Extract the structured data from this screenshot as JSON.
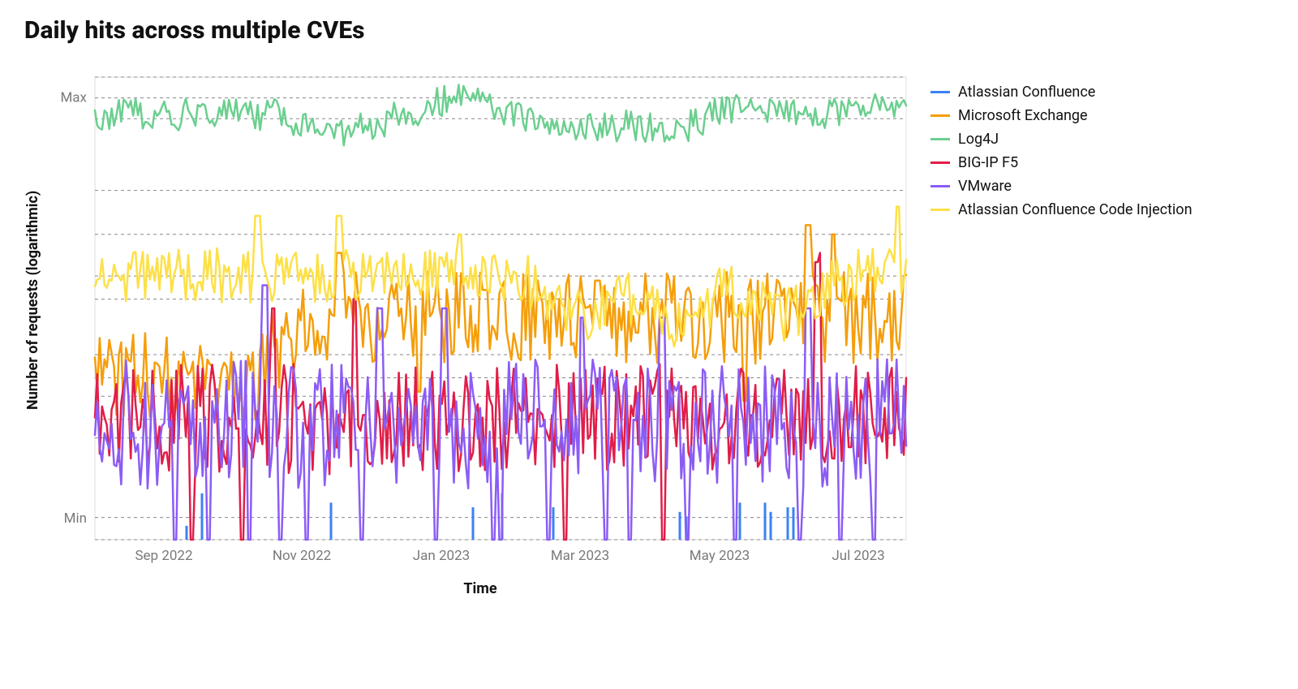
{
  "chart_data": {
    "type": "line",
    "title": "Daily hits across multiple CVEs",
    "xlabel": "Time",
    "ylabel": "Number of requests (logarithmic)",
    "y_ticks": [
      "Min",
      "Max"
    ],
    "x_ticks": [
      "Sep 2022",
      "Nov 2022",
      "Jan 2023",
      "Mar 2023",
      "May 2023",
      "Jul 2023"
    ],
    "x_tick_positions": [
      0.085,
      0.255,
      0.427,
      0.598,
      0.77,
      0.941
    ],
    "y_gridlines": [
      0.0,
      0.048,
      0.22,
      0.26,
      0.31,
      0.35,
      0.4,
      0.52,
      0.57,
      0.66,
      0.755,
      0.91,
      0.955,
      1.0
    ],
    "ylim_visual": [
      0,
      1
    ],
    "x_n_points": 340,
    "series": [
      {
        "name": "Atlassian Confluence",
        "color": "#3b82f6",
        "style": "stubs",
        "stub_x": [
          0.113,
          0.132,
          0.291,
          0.466,
          0.502,
          0.565,
          0.721,
          0.729,
          0.795,
          0.826,
          0.833,
          0.854,
          0.861
        ],
        "stub_y": [
          0.03,
          0.1,
          0.08,
          0.07,
          0.1,
          0.07,
          0.06,
          0.05,
          0.08,
          0.08,
          0.06,
          0.07,
          0.07
        ]
      },
      {
        "name": "Microsoft Exchange",
        "color": "#f59e0b",
        "style": "line",
        "profile": {
          "base": 0.35,
          "amp": 0.1,
          "rise_start": 0.18,
          "rise_end": 0.28,
          "rise_to": 0.48,
          "spikes": [
            [
              0.3,
              0.62
            ],
            [
              0.48,
              0.54
            ],
            [
              0.62,
              0.56
            ],
            [
              0.88,
              0.68
            ],
            [
              0.91,
              0.66
            ]
          ],
          "drops": [
            [
              0.2,
              0.26
            ],
            [
              0.4,
              0.32
            ],
            [
              0.8,
              0.3
            ]
          ]
        }
      },
      {
        "name": "Log4J",
        "color": "#6bcf8f",
        "style": "line",
        "profile": {
          "base": 0.92,
          "amp": 0.035,
          "dip": [
            [
              0.3,
              0.87
            ],
            [
              0.6,
              0.88
            ],
            [
              0.7,
              0.88
            ]
          ],
          "peak": [
            [
              0.45,
              0.97
            ],
            [
              0.8,
              0.94
            ],
            [
              0.99,
              0.95
            ]
          ]
        }
      },
      {
        "name": "BIG-IP F5",
        "color": "#e11d48",
        "style": "line",
        "profile": {
          "base": 0.26,
          "amp": 0.12,
          "drops": [
            [
              0.12,
              0.0
            ],
            [
              0.18,
              0.0
            ],
            [
              0.58,
              0.0
            ],
            [
              0.7,
              0.0
            ],
            [
              0.89,
              0.6
            ],
            [
              0.93,
              0.2
            ]
          ],
          "spikes": [
            [
              0.22,
              0.5
            ],
            [
              0.32,
              0.52
            ],
            [
              0.89,
              0.62
            ]
          ]
        }
      },
      {
        "name": "VMware",
        "color": "#8b5cf6",
        "style": "line",
        "profile": {
          "base": 0.25,
          "amp": 0.14,
          "drops": [
            [
              0.1,
              0.0
            ],
            [
              0.14,
              0.0
            ],
            [
              0.19,
              0.0
            ],
            [
              0.23,
              0.0
            ],
            [
              0.26,
              0.0
            ],
            [
              0.33,
              0.0
            ],
            [
              0.42,
              0.0
            ],
            [
              0.49,
              0.0
            ],
            [
              0.5,
              0.0
            ],
            [
              0.56,
              0.0
            ],
            [
              0.63,
              0.0
            ],
            [
              0.66,
              0.0
            ],
            [
              0.73,
              0.0
            ],
            [
              0.79,
              0.0
            ],
            [
              0.87,
              0.0
            ],
            [
              0.92,
              0.0
            ],
            [
              0.96,
              0.0
            ]
          ],
          "spikes": [
            [
              0.21,
              0.55
            ],
            [
              0.35,
              0.5
            ],
            [
              0.43,
              0.5
            ],
            [
              0.6,
              0.48
            ],
            [
              0.7,
              0.48
            ],
            [
              0.88,
              0.5
            ]
          ]
        }
      },
      {
        "name": "Atlassian Confluence Code Injection",
        "color": "#fde047",
        "style": "line",
        "profile": {
          "base": 0.57,
          "amp": 0.06,
          "spikes": [
            [
              0.2,
              0.7
            ],
            [
              0.3,
              0.7
            ],
            [
              0.45,
              0.66
            ],
            [
              0.99,
              0.72
            ]
          ],
          "dip": [
            [
              0.6,
              0.48
            ],
            [
              0.72,
              0.46
            ],
            [
              0.85,
              0.48
            ]
          ]
        }
      }
    ]
  }
}
